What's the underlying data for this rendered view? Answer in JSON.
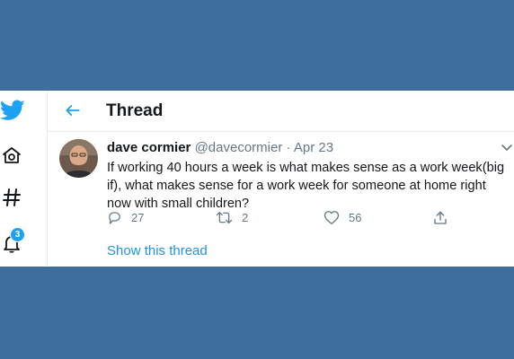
{
  "header": {
    "title": "Thread"
  },
  "nav": {
    "notifications_badge": "3"
  },
  "tweet": {
    "author": "dave cormier",
    "handle": "@davecormier",
    "separator": "·",
    "date": "Apr 23",
    "text": "If working 40 hours a week is what makes sense as a work week(big if), what makes sense for a work week for someone at home right now with small children?",
    "replies": "27",
    "retweets": "2",
    "likes": "56"
  },
  "show_thread_label": "Show this thread",
  "colors": {
    "accent": "#1da1f2",
    "background": "#3e6f9c",
    "text": "#14171a",
    "secondary": "#657786"
  }
}
